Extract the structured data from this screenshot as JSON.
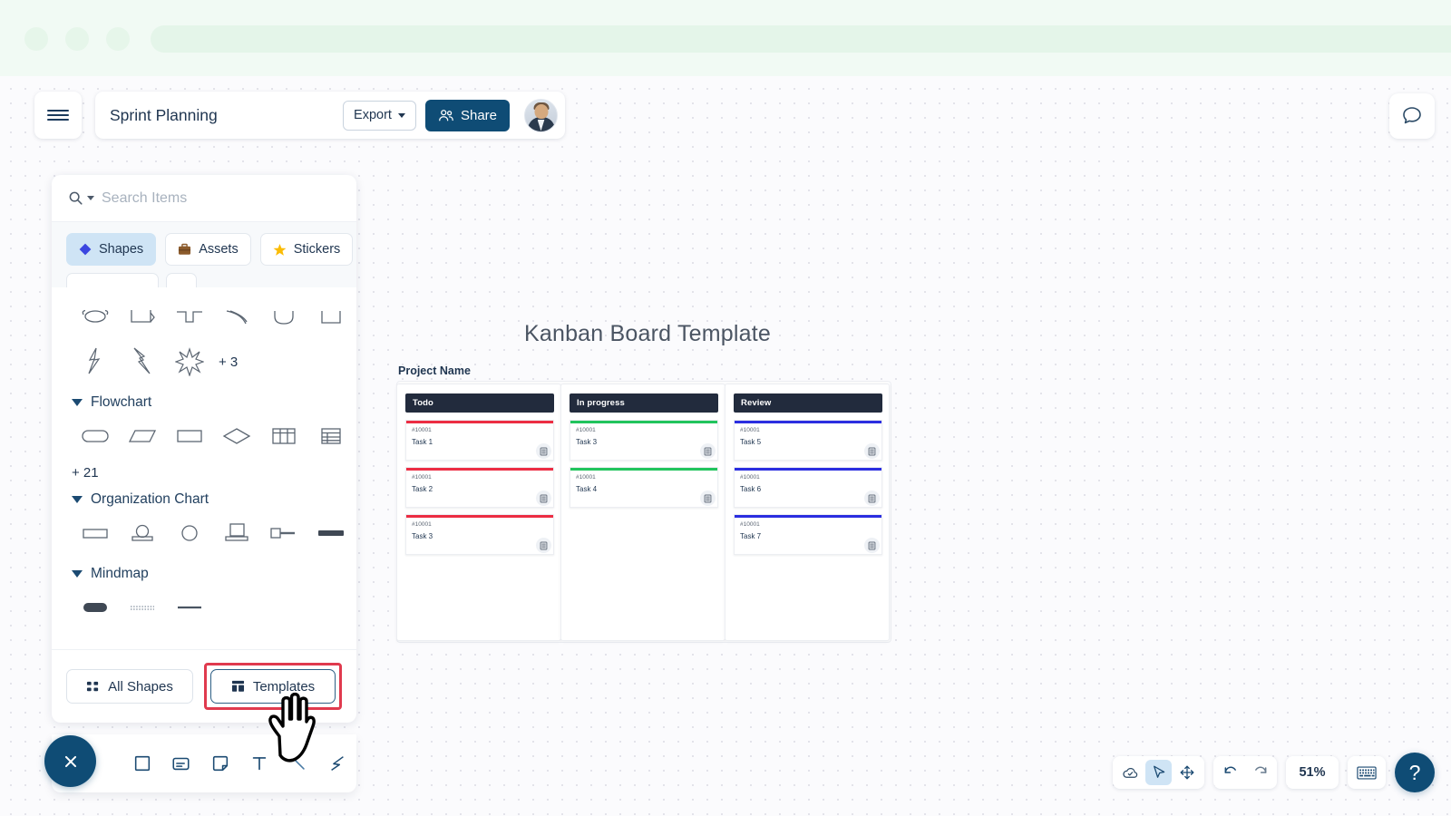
{
  "browser": {
    "dots": [
      "close-dot",
      "minimize-dot",
      "maximize-dot"
    ],
    "address_value": ""
  },
  "topbar": {
    "menu_icon": "hamburger-icon",
    "title": "Sprint Planning",
    "export_label": "Export",
    "share_label": "Share",
    "avatar_alt": "user-avatar",
    "chat_icon": "chat-bubble-icon"
  },
  "sidebar": {
    "search": {
      "placeholder": "Search Items",
      "value": "",
      "icon": "search-icon"
    },
    "tabs": [
      {
        "label": "Shapes",
        "icon": "diamond-icon",
        "active": true
      },
      {
        "label": "Assets",
        "icon": "briefcase-icon",
        "active": false
      },
      {
        "label": "Stickers",
        "icon": "star-icon",
        "active": false
      }
    ],
    "sections": [
      {
        "title": "",
        "collapsible": false,
        "rows": [
          [
            "cylinder-top-shape",
            "bracket-shape",
            "tee-shape",
            "arc-shape",
            "u-curve-shape",
            "u-bracket-shape"
          ],
          [
            "lightning-shape",
            "bolt-shape",
            "burst-shape"
          ]
        ],
        "more": "+ 3"
      },
      {
        "title": "Flowchart",
        "collapsible": true,
        "rows": [
          [
            "rounded-rect-shape",
            "parallelogram-shape",
            "rectangle-shape",
            "diamond-shape",
            "table-shape",
            "grid-shape"
          ]
        ],
        "more": "+ 21"
      },
      {
        "title": "Organization Chart",
        "collapsible": true,
        "rows": [
          [
            "org-box-shape",
            "org-person-shape",
            "org-circle-shape",
            "org-stack-shape",
            "org-node-shape",
            "org-bar-shape"
          ]
        ],
        "more": ""
      },
      {
        "title": "Mindmap",
        "collapsible": true,
        "rows": [
          [
            "mindmap-pill-shape",
            "mindmap-dotted-line-shape",
            "mindmap-line-shape"
          ]
        ],
        "more": ""
      }
    ],
    "footer": {
      "all_shapes_label": "All Shapes",
      "all_shapes_icon": "grid-dots-icon",
      "templates_label": "Templates",
      "templates_icon": "layout-icon",
      "templates_highlighted": true,
      "highlight_color": "#e03a4e"
    }
  },
  "tool_dock": {
    "close_icon": "close-x-icon",
    "tools": [
      {
        "icon": "square-icon",
        "name": "shape-tool"
      },
      {
        "icon": "card-icon",
        "name": "card-tool"
      },
      {
        "icon": "sticky-note-icon",
        "name": "note-tool"
      },
      {
        "icon": "text-icon",
        "name": "text-tool"
      },
      {
        "icon": "line-icon",
        "name": "line-tool"
      },
      {
        "icon": "pen-icon",
        "name": "pen-tool"
      }
    ]
  },
  "canvas": {
    "board_title": "Kanban Board Template",
    "project_name": "Project Name",
    "columns": [
      {
        "title": "Todo",
        "accent": "#ec2d43",
        "cards": [
          {
            "id": "#10001",
            "name": "Task 1"
          },
          {
            "id": "#10001",
            "name": "Task 2"
          },
          {
            "id": "#10001",
            "name": "Task 3"
          }
        ]
      },
      {
        "title": "In progress",
        "accent": "#21c45d",
        "cards": [
          {
            "id": "#10001",
            "name": "Task 3"
          },
          {
            "id": "#10001",
            "name": "Task 4"
          }
        ]
      },
      {
        "title": "Review",
        "accent": "#2b2ee0",
        "cards": [
          {
            "id": "#10001",
            "name": "Task 5"
          },
          {
            "id": "#10001",
            "name": "Task 6"
          },
          {
            "id": "#10001",
            "name": "Task 7"
          }
        ]
      }
    ]
  },
  "statusbar": {
    "cloud_icon": "cloud-saved-icon",
    "select_icon": "cursor-arrow-icon",
    "pan_icon": "move-icon",
    "undo_icon": "undo-icon",
    "redo_icon": "redo-icon",
    "zoom_level": "51%",
    "keyboard_icon": "keyboard-icon",
    "help_label": "?"
  }
}
